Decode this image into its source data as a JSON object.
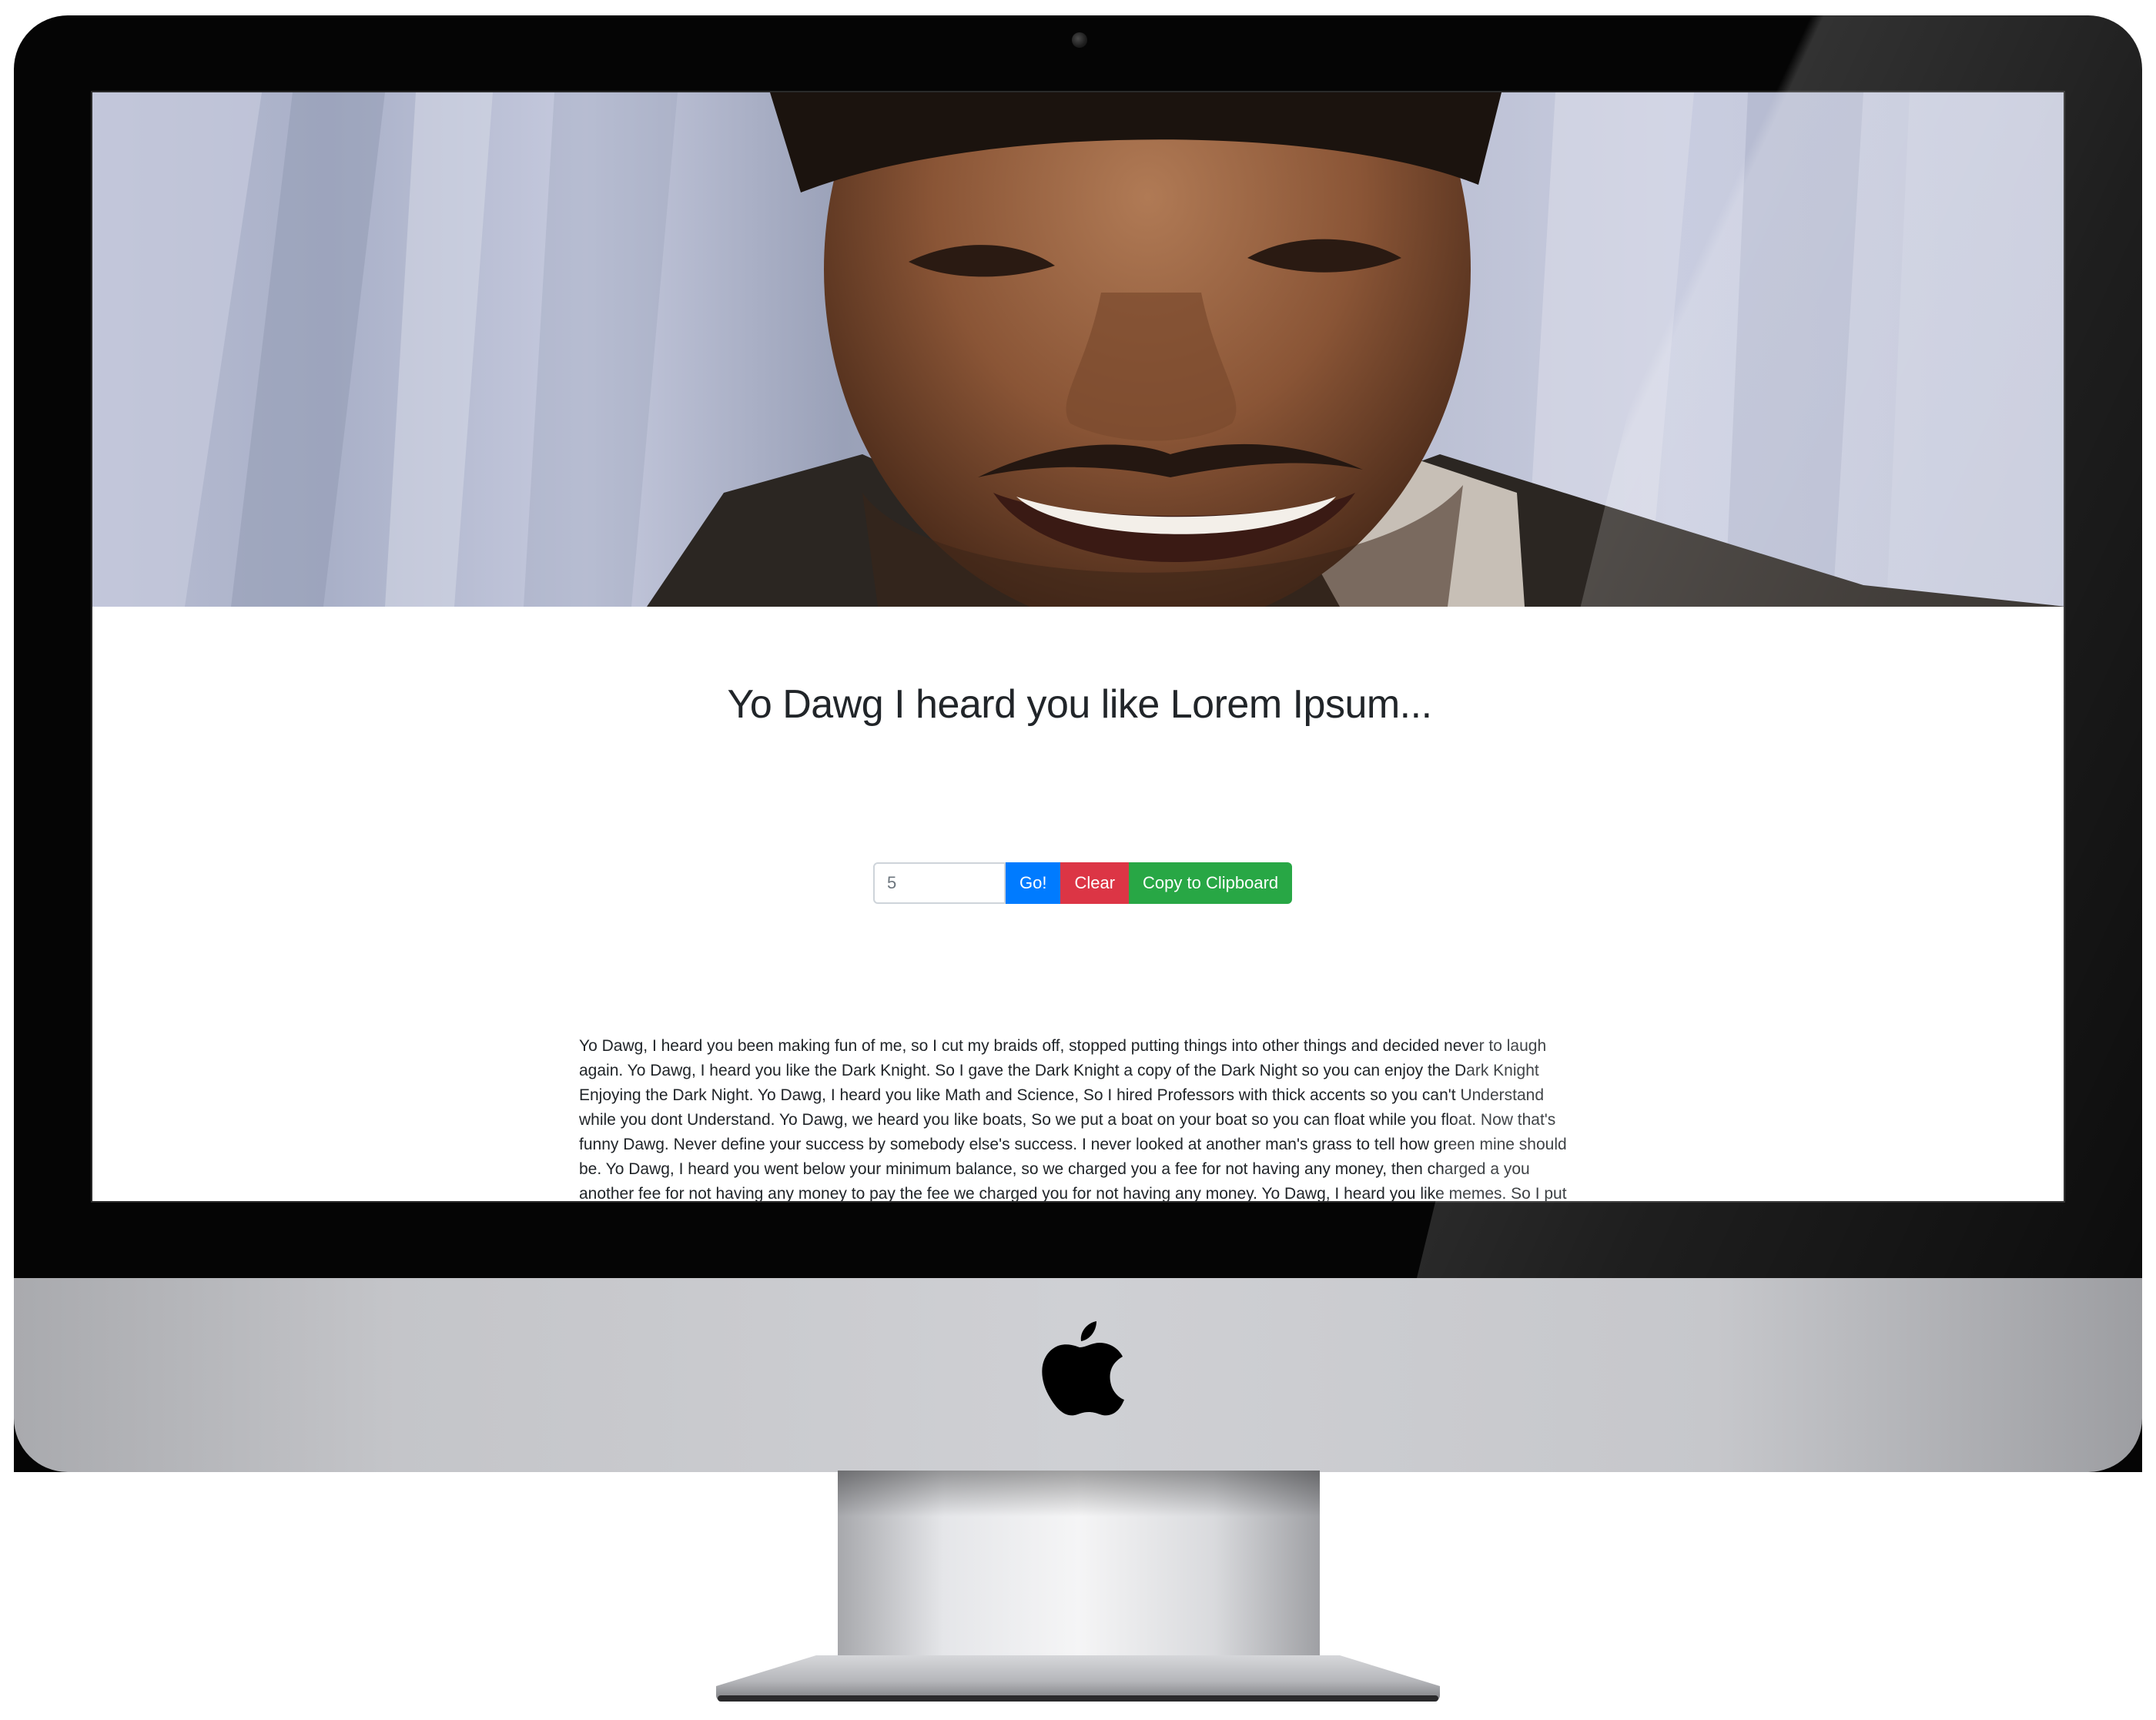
{
  "page": {
    "title": "Yo Dawg I heard you like Lorem Ipsum...",
    "paragraph": "Yo Dawg, I heard you been making fun of me, so I cut my braids off, stopped putting things into other things and decided never to laugh again. Yo Dawg, I heard you like the Dark Knight. So I gave the Dark Knight a copy of the Dark Night so you can enjoy the Dark Knight Enjoying the Dark Night. Yo Dawg, I heard you like Math and Science, So I hired Professors with thick accents so you can't Understand while you dont Understand. Yo Dawg, we heard you like boats, So we put a boat on your boat so you can float while you float. Now that's funny Dawg. Never define your success by somebody else's success. I never looked at another man's grass to tell how green mine should be. Yo Dawg, I heard you went below your minimum balance, so we charged you a fee for not having any money, then charged a you another fee for not having any money to pay the fee we charged you for not having any money. Yo Dawg, I heard you like memes. So I put a meme in your meme so you can meme while you meme. Yo Dawg, we heard you like Exhibits so we"
  },
  "controls": {
    "count_value": "5",
    "go_label": "Go!",
    "clear_label": "Clear",
    "copy_label": "Copy to Clipboard"
  },
  "colors": {
    "go": "#007bff",
    "clear": "#dc3545",
    "copy": "#28a745",
    "text": "#212529"
  }
}
